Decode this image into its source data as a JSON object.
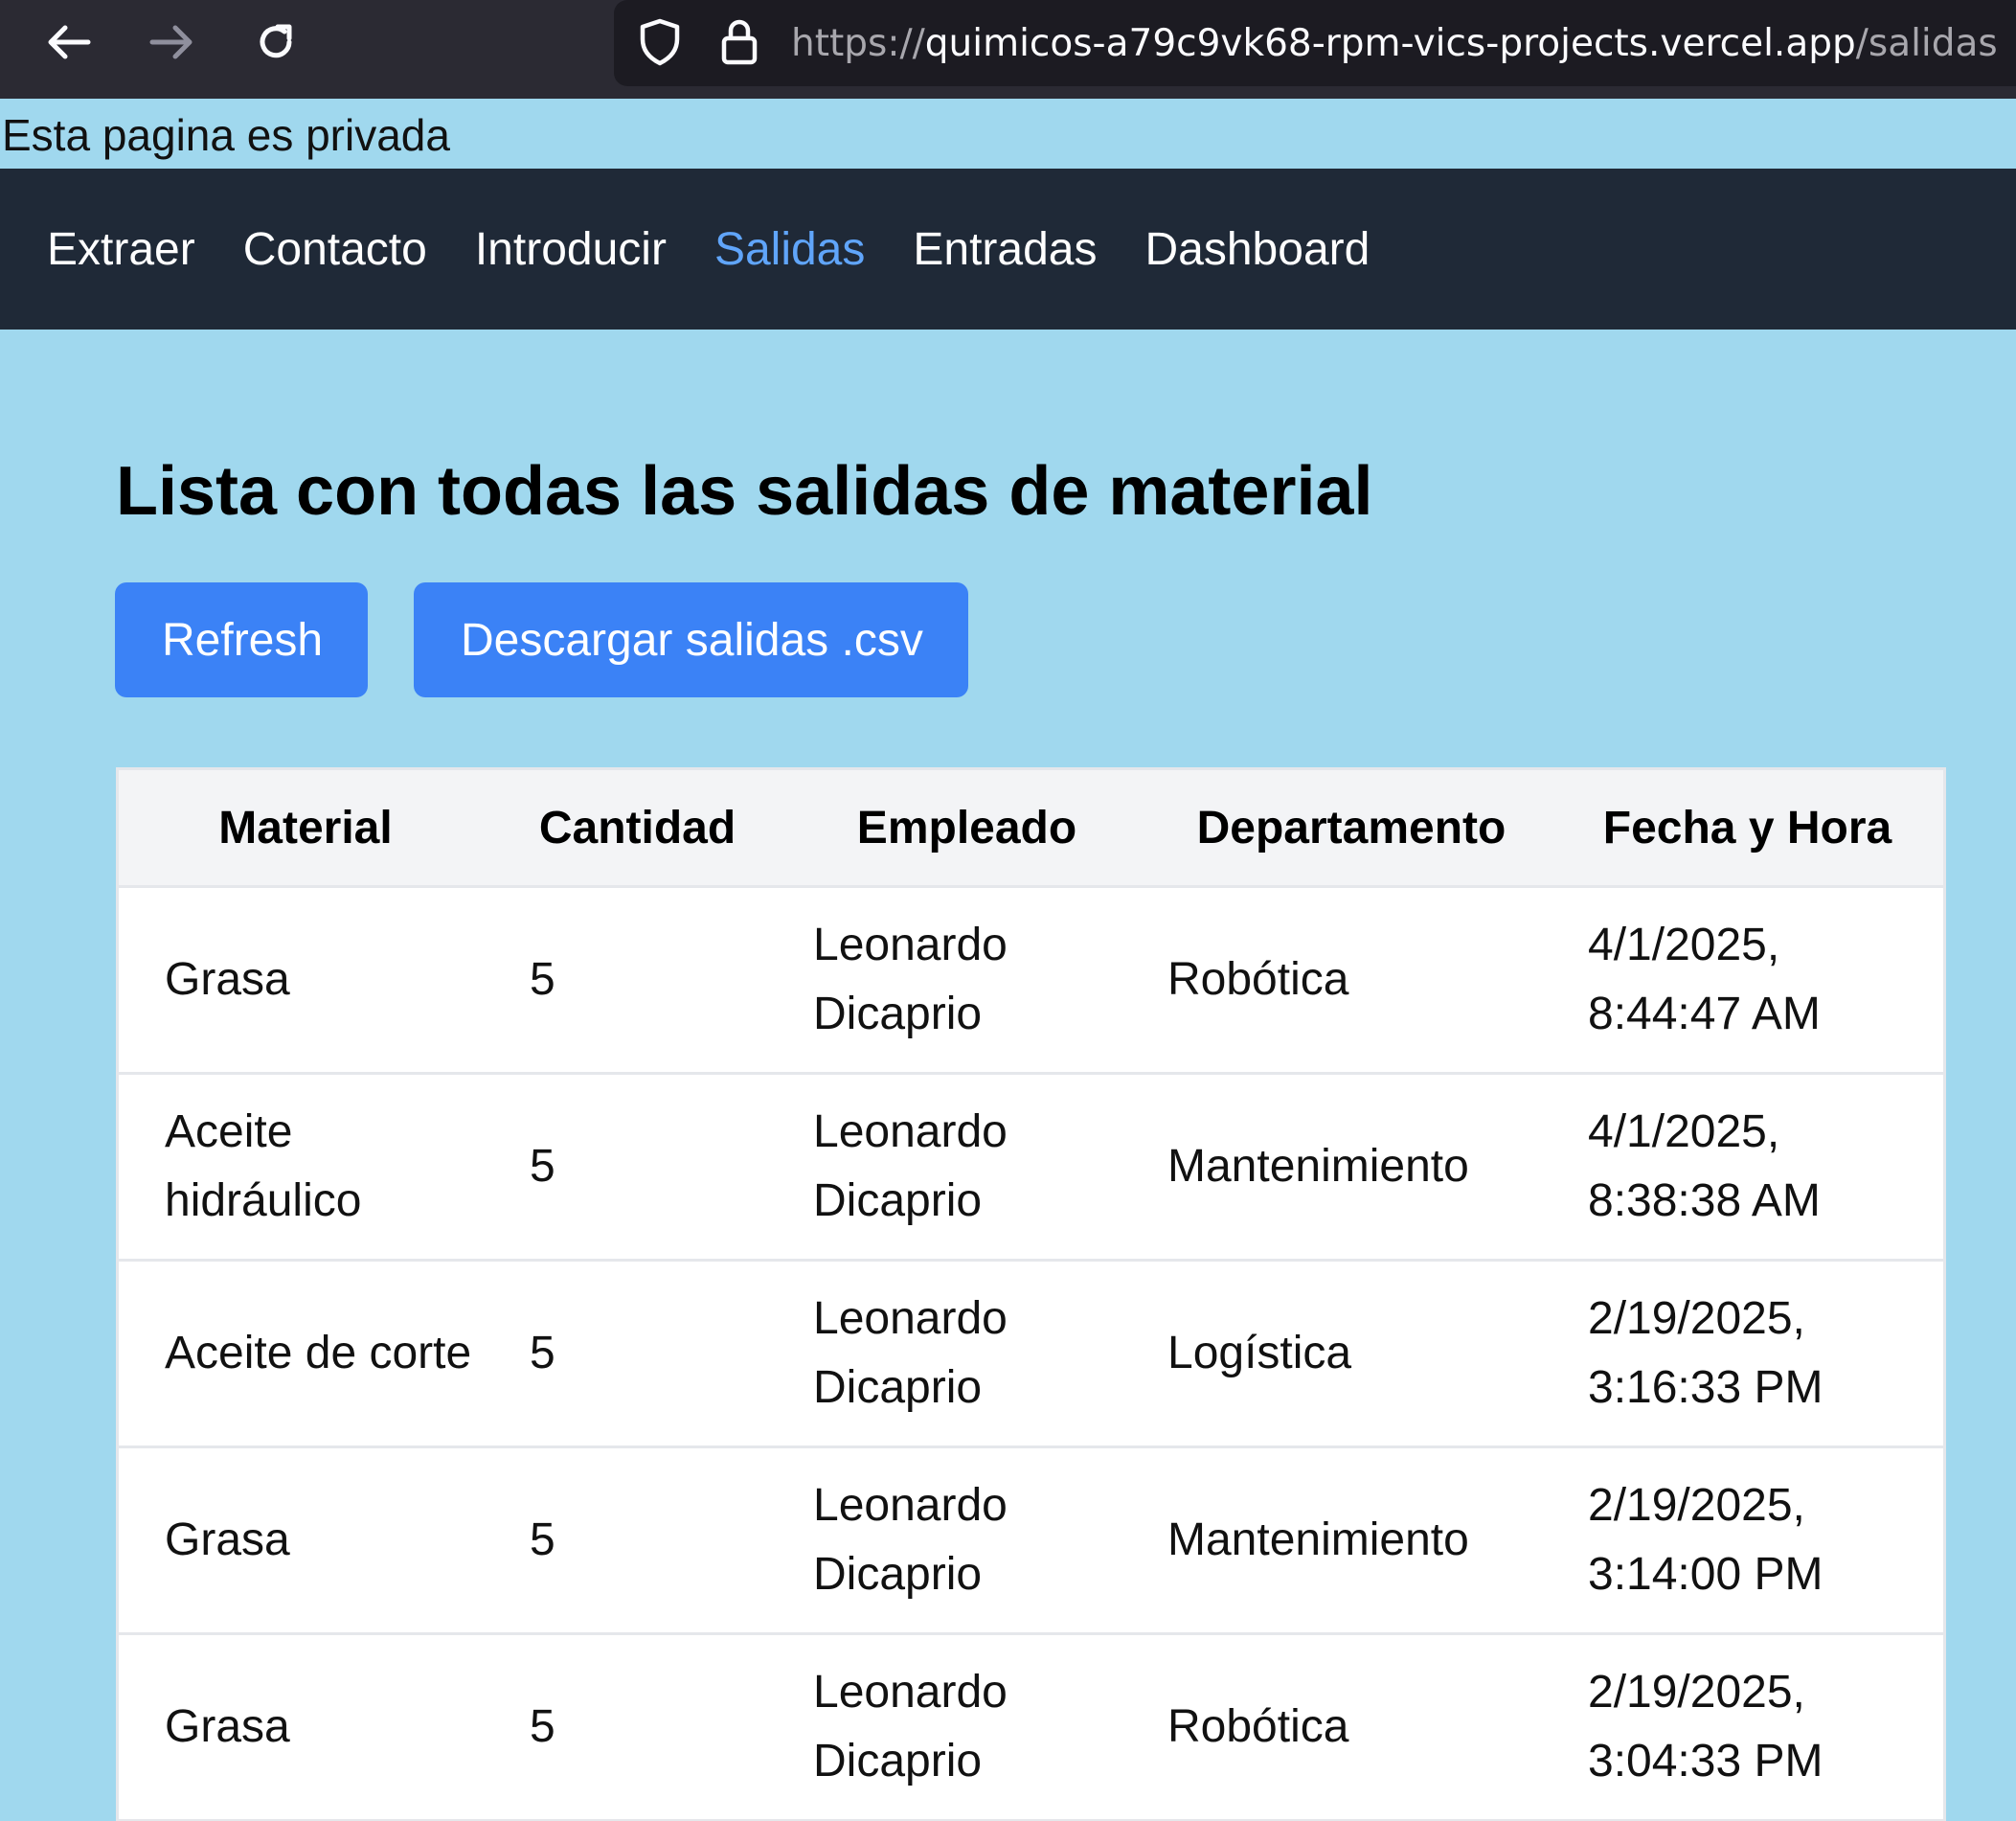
{
  "browser": {
    "url_scheme": "https://",
    "url_host": "quimicos-a79c9vk68-rpm-vics-projects.vercel.app",
    "url_path": "/salidas"
  },
  "banner": {
    "text": "Esta pagina es privada"
  },
  "nav": {
    "items": [
      {
        "label": "Extraer"
      },
      {
        "label": "Contacto"
      },
      {
        "label": "Introducir"
      },
      {
        "label": "Salidas"
      },
      {
        "label": "Entradas"
      },
      {
        "label": "Dashboard"
      }
    ],
    "active": "Salidas"
  },
  "main": {
    "title": "Lista con todas las salidas de material",
    "refresh_label": "Refresh",
    "download_label": "Descargar salidas .csv"
  },
  "table": {
    "headers": [
      "Material",
      "Cantidad",
      "Empleado",
      "Departamento",
      "Fecha y Hora"
    ],
    "rows": [
      [
        "Grasa",
        "5",
        "Leonardo Dicaprio",
        "Robótica",
        "4/1/2025, 8:44:47 AM"
      ],
      [
        "Aceite hidráulico",
        "5",
        "Leonardo Dicaprio",
        "Mantenimiento",
        "4/1/2025, 8:38:38 AM"
      ],
      [
        "Aceite de corte",
        "5",
        "Leonardo Dicaprio",
        "Logística",
        "2/19/2025, 3:16:33 PM"
      ],
      [
        "Grasa",
        "5",
        "Leonardo Dicaprio",
        "Mantenimiento",
        "2/19/2025, 3:14:00 PM"
      ],
      [
        "Grasa",
        "5",
        "Leonardo Dicaprio",
        "Robótica",
        "2/19/2025, 3:04:33 PM"
      ]
    ]
  },
  "colors": {
    "page_bg": "#a0d8ee",
    "nav_bg": "#1f2937",
    "nav_active": "#60a5fa",
    "button_bg": "#3b82f6",
    "header_bg": "#f3f4f6"
  }
}
